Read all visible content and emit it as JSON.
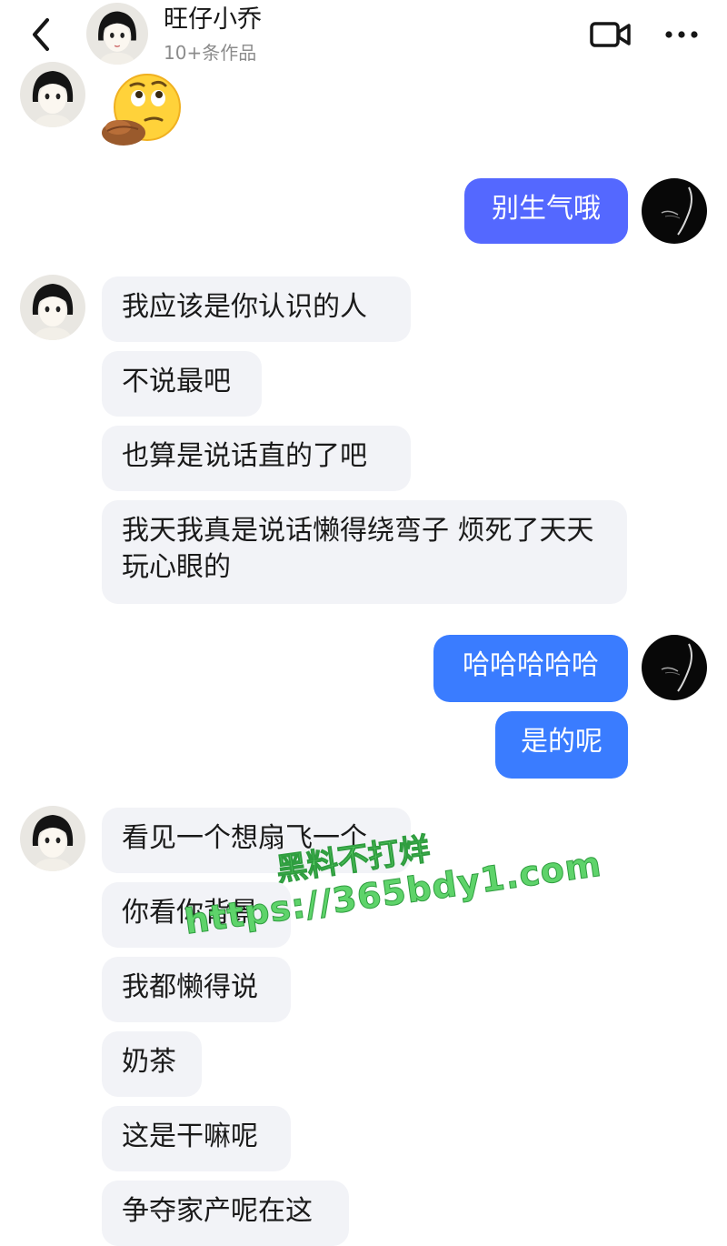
{
  "header": {
    "name": "旺仔小乔",
    "subtitle": "10+条作品",
    "back_icon": "chevron-left-icon",
    "video_icon": "video-call-icon",
    "more_icon": "more-horizontal-icon"
  },
  "colors": {
    "outgoing_indigo": "#5468ff",
    "outgoing_blue": "#3a7cff",
    "incoming_bg": "#f2f3f7",
    "watermark_green": "#5ed36a"
  },
  "messages": [
    {
      "sender": "them",
      "type": "sticker",
      "sticker": "thinking-face-emoji"
    },
    {
      "sender": "me",
      "text": "别生气哦"
    },
    {
      "sender": "them",
      "text": "我应该是你认识的人"
    },
    {
      "sender": "them",
      "text": "不说最吧"
    },
    {
      "sender": "them",
      "text": "也算是说话直的了吧"
    },
    {
      "sender": "them",
      "text": "我天我真是说话懒得绕弯子 烦死了天天玩心眼的"
    },
    {
      "sender": "me",
      "text": "哈哈哈哈哈"
    },
    {
      "sender": "me",
      "text": "是的呢"
    },
    {
      "sender": "them",
      "text": "看见一个想扇飞一个"
    },
    {
      "sender": "them",
      "text": "你看你背景"
    },
    {
      "sender": "them",
      "text": "我都懒得说"
    },
    {
      "sender": "them",
      "text": "奶茶"
    },
    {
      "sender": "them",
      "text": "这是干嘛呢"
    },
    {
      "sender": "them",
      "text": "争夺家产呢在这"
    }
  ],
  "watermark": {
    "line1": "黑料不打烊",
    "line2": "https://365bdy1.com"
  }
}
